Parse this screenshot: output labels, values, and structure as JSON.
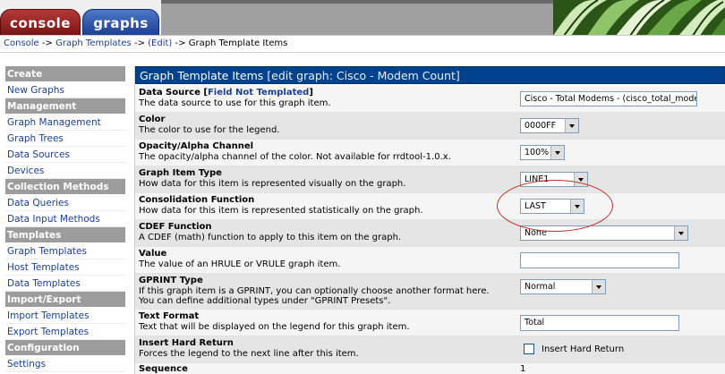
{
  "tabs": [
    {
      "label": "console"
    },
    {
      "label": "graphs"
    }
  ],
  "breadcrumb": {
    "items": [
      "Console",
      "Graph Templates",
      "(Edit)"
    ],
    "current": "Graph Template Items",
    "separator": "->"
  },
  "sidebar": {
    "sections": [
      {
        "header": "Create",
        "items": [
          "New Graphs"
        ]
      },
      {
        "header": "Management",
        "items": [
          "Graph Management",
          "Graph Trees",
          "Data Sources",
          "Devices"
        ]
      },
      {
        "header": "Collection Methods",
        "items": [
          "Data Queries",
          "Data Input Methods"
        ]
      },
      {
        "header": "Templates",
        "items": [
          "Graph Templates",
          "Host Templates",
          "Data Templates"
        ]
      },
      {
        "header": "Import/Export",
        "items": [
          "Import Templates",
          "Export Templates"
        ]
      },
      {
        "header": "Configuration",
        "items": [
          "Settings"
        ]
      }
    ]
  },
  "main": {
    "title": "Graph Template Items",
    "subtitle": "[edit graph: Cisco - Modem Count]",
    "fields": [
      {
        "label": "Data Source [",
        "label_flag": "Field Not Templated",
        "label_end": "]",
        "desc": "The data source to use for this graph item.",
        "value": "Cisco - Total Modems - (cisco_total_modems)"
      },
      {
        "label": "Color",
        "desc": "The color to use for the legend.",
        "value": "0000FF"
      },
      {
        "label": "Opacity/Alpha Channel",
        "desc": "The opacity/alpha channel of the color. Not available for rrdtool-1.0.x.",
        "value": "100%"
      },
      {
        "label": "Graph Item Type",
        "desc": "How data for this item is represented visually on the graph.",
        "value": "LINE1"
      },
      {
        "label": "Consolidation Function",
        "desc": "How data for this item is represented statistically on the graph.",
        "value": "LAST"
      },
      {
        "label": "CDEF Function",
        "desc": "A CDEF (math) function to apply to this item on the graph.",
        "value": "None"
      },
      {
        "label": "Value",
        "desc": "The value of an HRULE or VRULE graph item.",
        "value": ""
      },
      {
        "label": "GPRINT Type",
        "desc": "If this graph item is a GPRINT, you can optionally choose another format here. You can define additional types under \"GPRINT Presets\".",
        "value": "Normal"
      },
      {
        "label": "Text Format",
        "desc": "Text that will be displayed on the legend for this graph item.",
        "value": "Total"
      },
      {
        "label": "Insert Hard Return",
        "desc": "Forces the legend to the next line after this item.",
        "value": "Insert Hard Return"
      },
      {
        "label": "Sequence",
        "desc": "",
        "value": "1"
      }
    ]
  },
  "colors": {
    "title_bg": "#00438c",
    "console_tab": "#9b2a2a",
    "graphs_tab": "#2f56ad",
    "link": "#1c3f94",
    "annotation_circle": "#c0302a"
  }
}
